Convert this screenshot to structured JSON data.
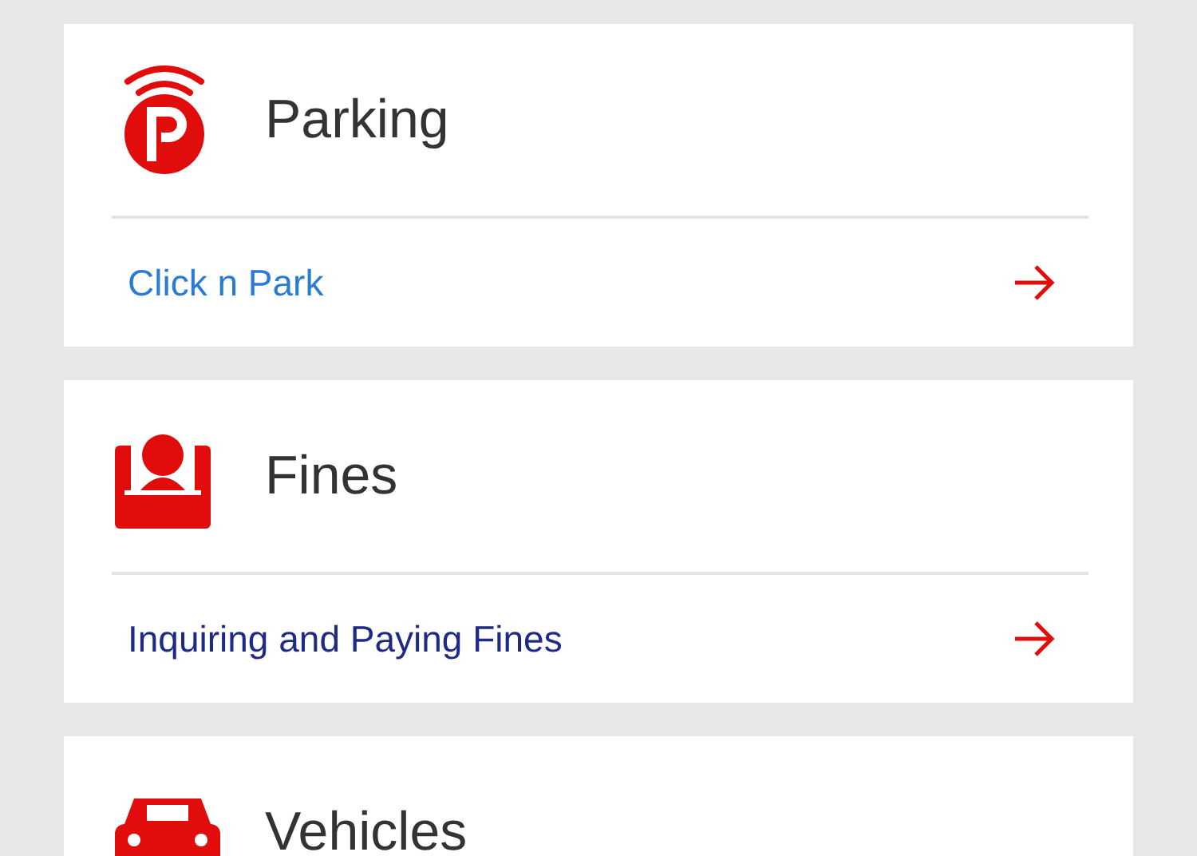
{
  "cards": [
    {
      "kind": "parking",
      "title": "Parking",
      "link": {
        "label": "Click n Park",
        "color": "#2a7bd4"
      }
    },
    {
      "kind": "fines",
      "title": "Fines",
      "link": {
        "label": "Inquiring and Paying Fines",
        "color": "#1f2a86"
      }
    },
    {
      "kind": "vehicle",
      "title": "Vehicles"
    }
  ]
}
